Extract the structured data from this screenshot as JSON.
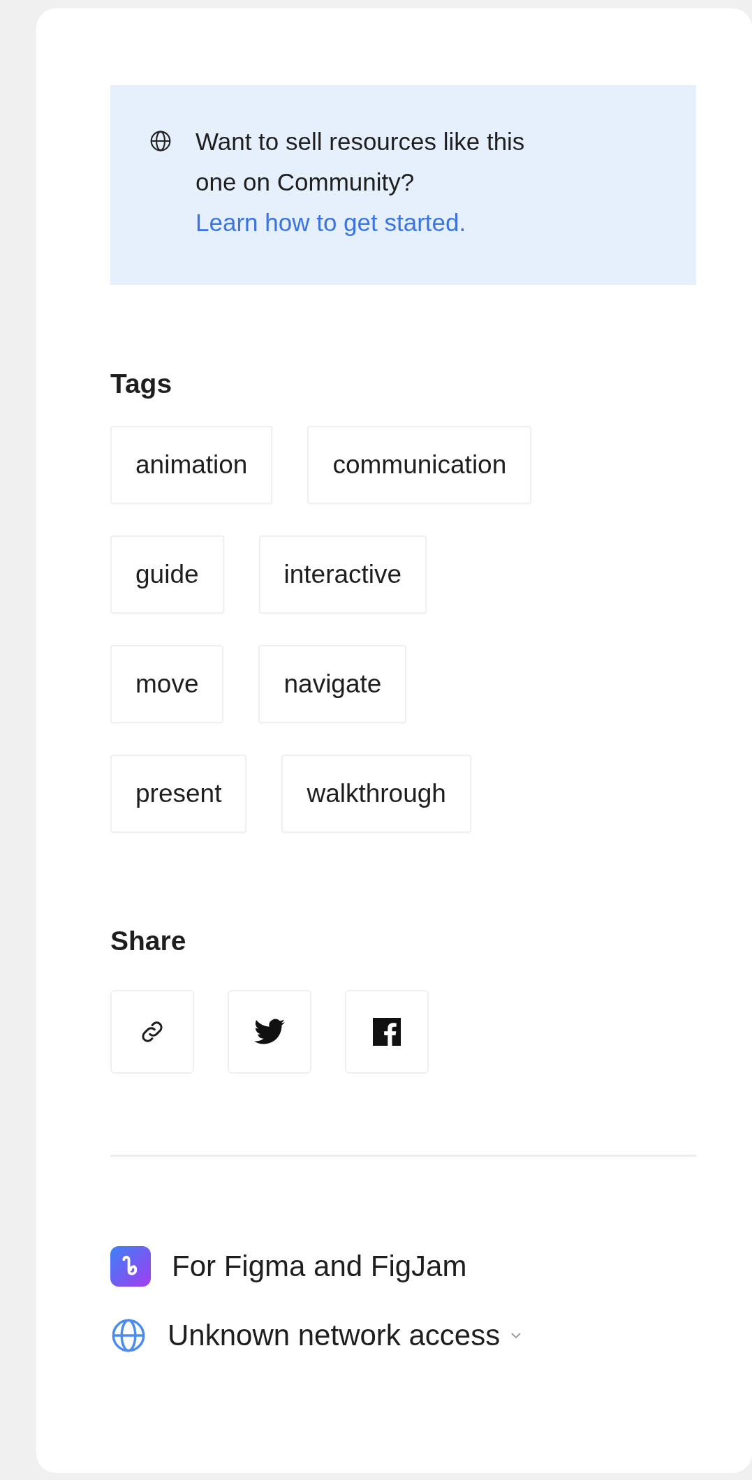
{
  "promo_banner": {
    "message": "Want to sell resources like this one on Community?",
    "link": "Learn how to get started."
  },
  "tags": {
    "heading": "Tags",
    "items": [
      "animation",
      "communication",
      "guide",
      "interactive",
      "move",
      "navigate",
      "present",
      "walkthrough"
    ]
  },
  "share": {
    "heading": "Share",
    "buttons": [
      {
        "kind": "link"
      },
      {
        "kind": "twitter"
      },
      {
        "kind": "facebook"
      }
    ]
  },
  "info": [
    {
      "kind": "platform",
      "text": "For Figma and FigJam"
    },
    {
      "kind": "network",
      "text": "Unknown network access",
      "expandable": true
    }
  ]
}
